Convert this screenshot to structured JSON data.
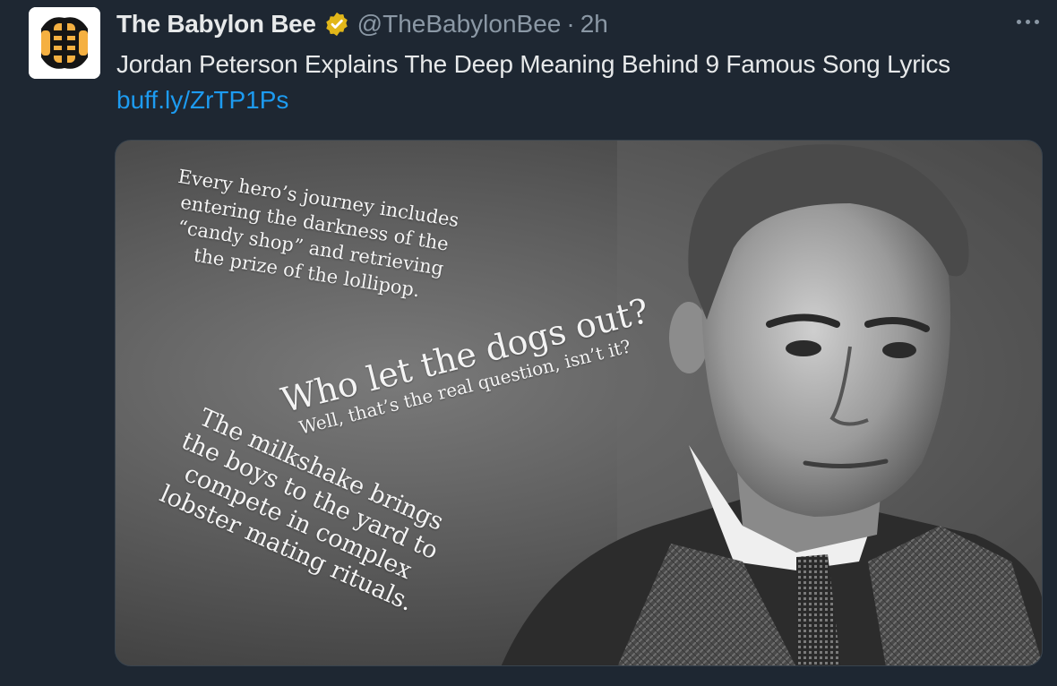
{
  "account": {
    "display_name": "The Babylon Bee",
    "handle": "@TheBabylonBee",
    "separator": "·",
    "timestamp": "2h",
    "avatar_icon": "babylon-bee-logo",
    "verified_icon": "verified-badge-icon"
  },
  "tweet": {
    "text": "Jordan Peterson Explains The Deep Meaning Behind 9 Famous Song Lyrics",
    "link": "buff.ly/ZrTP1Ps"
  },
  "media": {
    "quotes": [
      "Every hero’s journey includes\nentering the darkness of the\n“candy shop” and retrieving\nthe prize of the lollipop.",
      "Who let the dogs out?",
      "Well, that’s the real question, isn’t it?",
      "The milkshake brings\nthe boys to the yard to\ncompete in complex\nlobster mating rituals."
    ]
  },
  "colors": {
    "background": "#1e2732",
    "link": "#1d9bf0",
    "secondary_text": "#8b98a5",
    "verified_gold": "#e2b719"
  }
}
